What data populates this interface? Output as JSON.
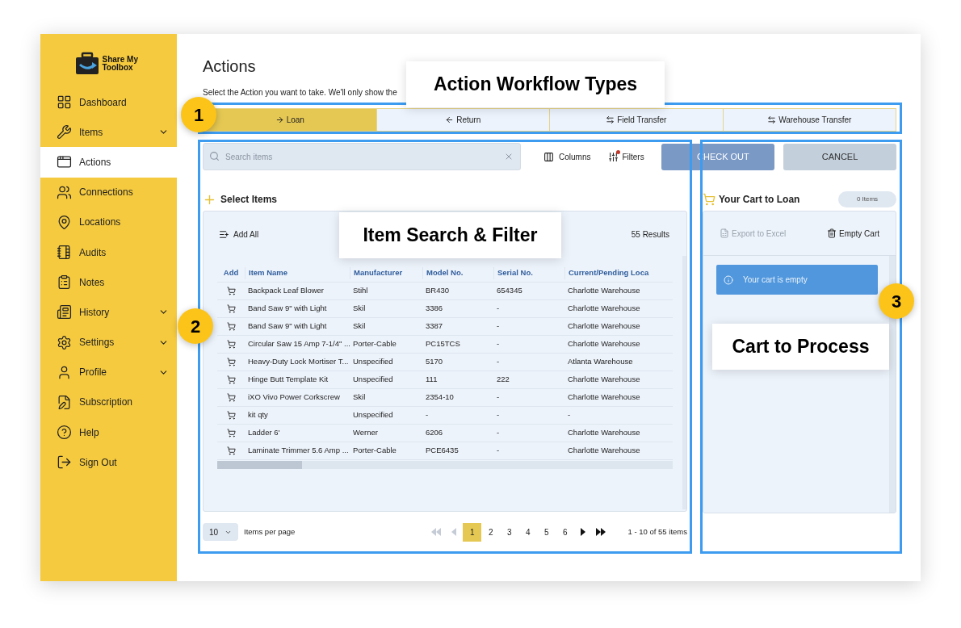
{
  "sidebar": {
    "logo": "Share My Toolbox",
    "items": [
      {
        "label": "Dashboard",
        "selected": false,
        "expandable": false
      },
      {
        "label": "Items",
        "selected": false,
        "expandable": true
      },
      {
        "label": "Actions",
        "selected": true,
        "expandable": false
      },
      {
        "label": "Connections",
        "selected": false,
        "expandable": false
      },
      {
        "label": "Locations",
        "selected": false,
        "expandable": false
      },
      {
        "label": "Audits",
        "selected": false,
        "expandable": false
      },
      {
        "label": "Notes",
        "selected": false,
        "expandable": false
      },
      {
        "label": "History",
        "selected": false,
        "expandable": true
      },
      {
        "label": "Settings",
        "selected": false,
        "expandable": true
      },
      {
        "label": "Profile",
        "selected": false,
        "expandable": true
      },
      {
        "label": "Subscription",
        "selected": false,
        "expandable": false
      },
      {
        "label": "Help",
        "selected": false,
        "expandable": false
      },
      {
        "label": "Sign Out",
        "selected": false,
        "expandable": false
      }
    ]
  },
  "page": {
    "title": "Actions",
    "subtitle": "Select the Action you want to take. We'll only show the"
  },
  "tabs": [
    {
      "label": "Loan",
      "kind": "forward",
      "selected": true
    },
    {
      "label": "Return",
      "kind": "back",
      "selected": false
    },
    {
      "label": "Field Transfer",
      "kind": "swap",
      "selected": false
    },
    {
      "label": "Warehouse Transfer",
      "kind": "swap",
      "selected": false
    }
  ],
  "toolbar": {
    "search": {
      "placeholder": "Search items"
    },
    "columns": "Columns",
    "filters": "Filters",
    "filters_active": true,
    "checkout": "CHECK OUT",
    "cancel": "CANCEL"
  },
  "items_panel": {
    "title": "Select Items",
    "add_all": "Add All",
    "results": "55 Results",
    "table": {
      "add_column": "Add",
      "columns": [
        "Item Name",
        "Manufacturer",
        "Model No.",
        "Serial No.",
        "Current/Pending Loca"
      ],
      "rows": [
        [
          "Backpack Leaf Blower",
          "Stihl",
          "BR430",
          "654345",
          "Charlotte Warehouse"
        ],
        [
          "Band Saw 9\" with Light",
          "Skil",
          "3386",
          "-",
          "Charlotte Warehouse"
        ],
        [
          "Band Saw 9\" with Light",
          "Skil",
          "3387",
          "-",
          "Charlotte Warehouse"
        ],
        [
          "Circular Saw 15 Amp 7-1/4\" ...",
          "Porter-Cable",
          "PC15TCS",
          "-",
          "Charlotte Warehouse"
        ],
        [
          "Heavy-Duty Lock Mortiser T...",
          "Unspecified",
          "5170",
          "-",
          "Atlanta Warehouse"
        ],
        [
          "Hinge Butt Template Kit",
          "Unspecified",
          "111",
          "222",
          "Charlotte Warehouse"
        ],
        [
          "iXO Vivo Power Corkscrew",
          "Skil",
          "2354-10",
          "-",
          "Charlotte Warehouse"
        ],
        [
          "kit qty",
          "Unspecified",
          "-",
          "-",
          "-"
        ],
        [
          "Ladder 6'",
          "Werner",
          "6206",
          "-",
          "Charlotte Warehouse"
        ],
        [
          "Laminate Trimmer 5.6 Amp ...",
          "Porter-Cable",
          "PCE6435",
          "-",
          "Charlotte Warehouse"
        ]
      ]
    },
    "pagination": {
      "page_size": "10",
      "page_size_label": "Items per page",
      "nav": [
        {
          "kind": "first",
          "disabled": true
        },
        {
          "kind": "prev",
          "disabled": true
        },
        {
          "kind": "next",
          "disabled": false
        },
        {
          "kind": "last",
          "disabled": false
        }
      ],
      "pages": [
        {
          "label": "1",
          "selected": true
        },
        {
          "label": "2",
          "selected": false
        },
        {
          "label": "3",
          "selected": false
        },
        {
          "label": "4",
          "selected": false
        },
        {
          "label": "5",
          "selected": false
        },
        {
          "label": "6",
          "selected": false
        }
      ],
      "summary": "1 - 10 of 55 items"
    }
  },
  "cart": {
    "title": "Your Cart to Loan",
    "count": "0 Items",
    "export": "Export to Excel",
    "export_disabled": true,
    "empty_cart": "Empty Cart",
    "message": "Your cart is empty"
  },
  "annotations": {
    "callouts": [
      "Action Workflow Types",
      "Item Search & Filter",
      "Cart to Process"
    ],
    "badges": [
      "1",
      "2",
      "3"
    ]
  }
}
